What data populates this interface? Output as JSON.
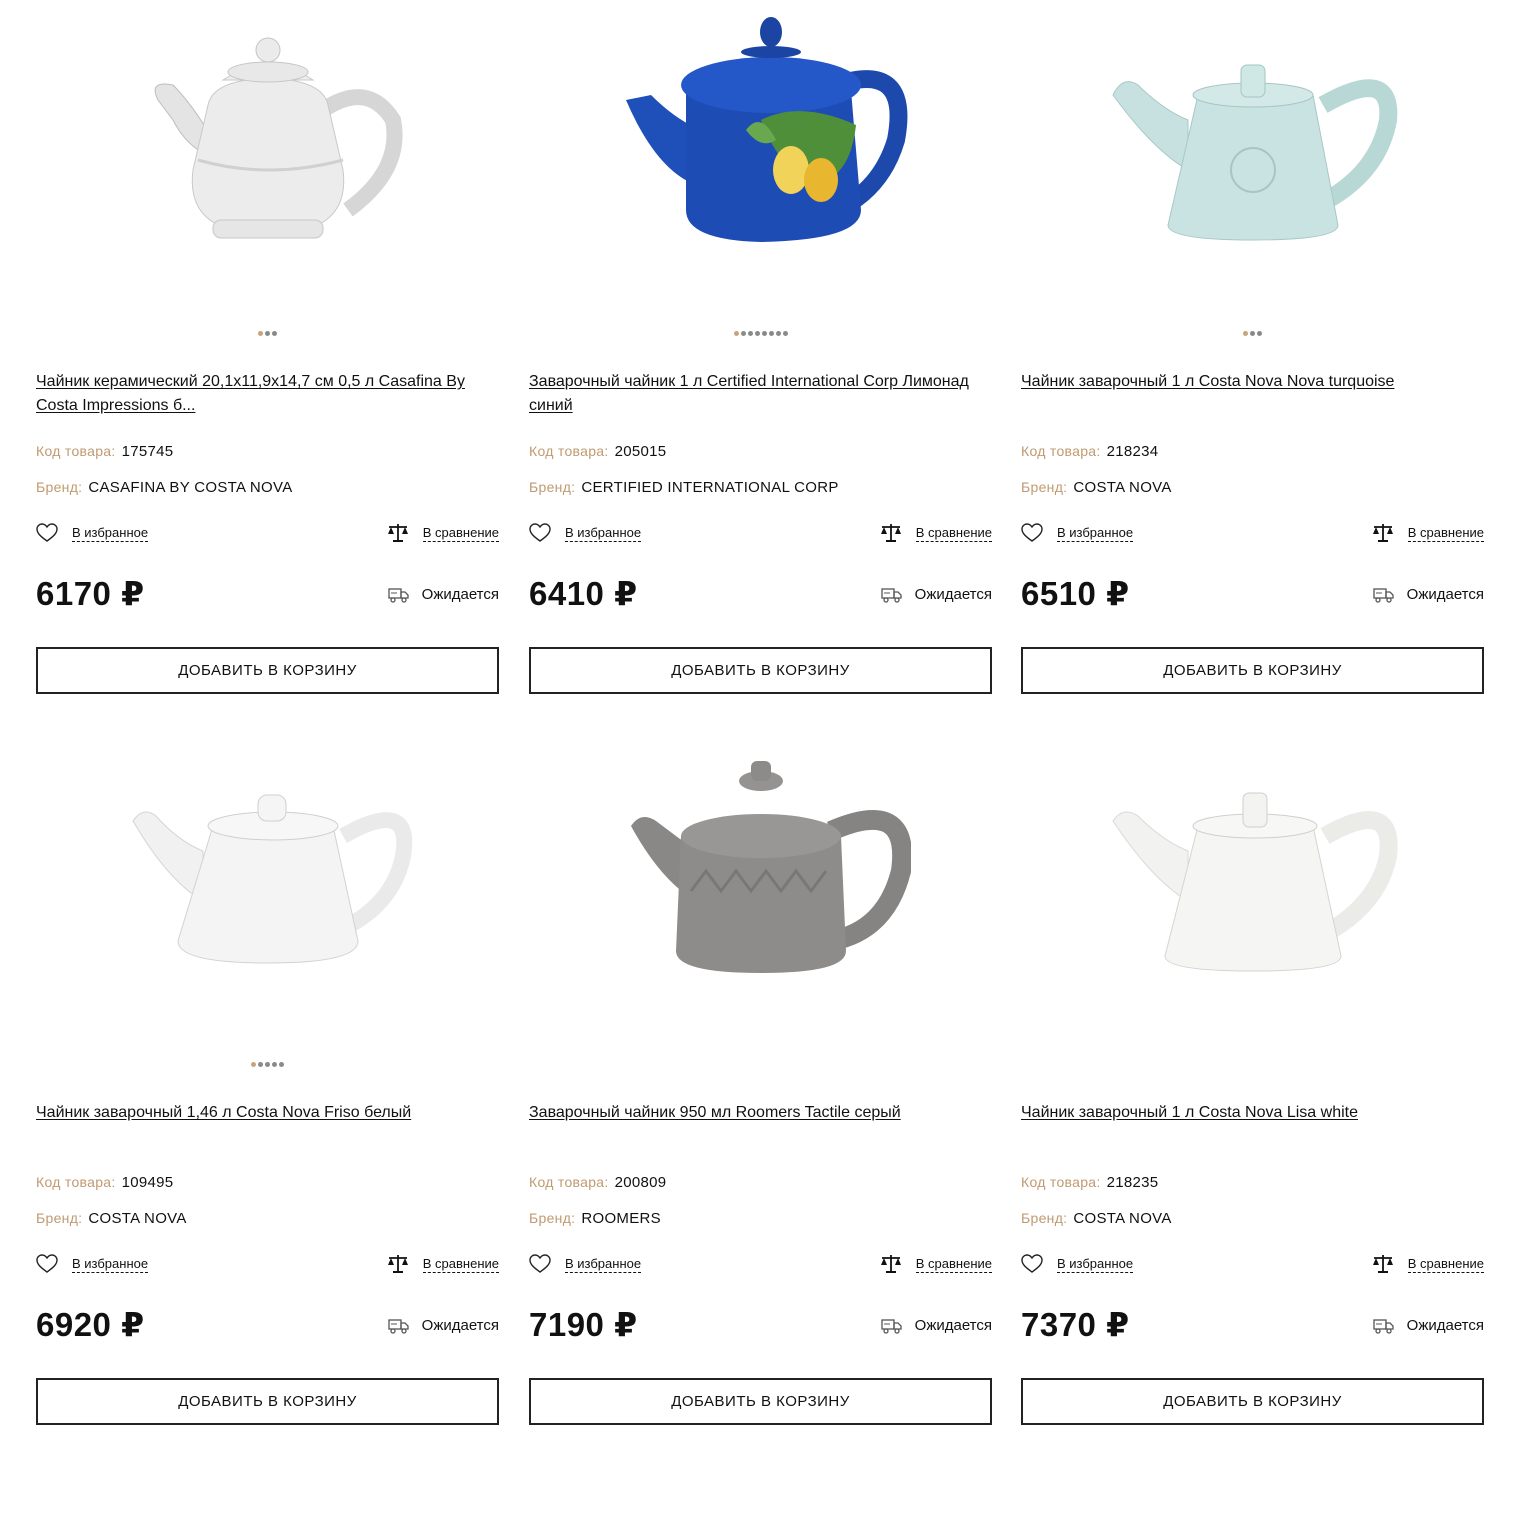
{
  "labels": {
    "code": "Код товара:",
    "brand": "Бренд:",
    "favorite": "В избранное",
    "compare": "В сравнение",
    "availability": "Ожидается",
    "add_to_cart": "ДОБАВИТЬ В КОРЗИНУ"
  },
  "colors": {
    "accent": "#c09a70",
    "text": "#111111",
    "button_border": "#222222"
  },
  "products": [
    {
      "title": "Чайник керамический 20,1х11,9х14,7 см 0,5 л Casafina By Costa Impressions б...",
      "code": "175745",
      "brand": "CASAFINA BY COSTA NOVA",
      "price": "6170 ₽",
      "image_dots": 3,
      "image": "white-ornate-teapot"
    },
    {
      "title": "Заварочный чайник 1 л Certified International Corp Лимонад синий",
      "code": "205015",
      "brand": "CERTIFIED INTERNATIONAL CORP",
      "price": "6410 ₽",
      "image_dots": 8,
      "image": "blue-lemon-teapot"
    },
    {
      "title": "Чайник заварочный 1 л Costa Nova Nova turquoise",
      "code": "218234",
      "brand": "COSTA NOVA",
      "price": "6510 ₽",
      "image_dots": 3,
      "image": "turquoise-teapot"
    },
    {
      "title": "Чайник заварочный 1,46 л Costa Nova Friso белый",
      "code": "109495",
      "brand": "COSTA NOVA",
      "price": "6920 ₽",
      "image_dots": 5,
      "image": "white-friso-teapot"
    },
    {
      "title": "Заварочный чайник 950 мл Roomers Tactile серый",
      "code": "200809",
      "brand": "ROOMERS",
      "price": "7190 ₽",
      "image_dots": 0,
      "image": "grey-tactile-teapot"
    },
    {
      "title": "Чайник заварочный 1 л Costa Nova Lisa white",
      "code": "218235",
      "brand": "COSTA NOVA",
      "price": "7370 ₽",
      "image_dots": 0,
      "image": "white-lisa-teapot"
    }
  ]
}
